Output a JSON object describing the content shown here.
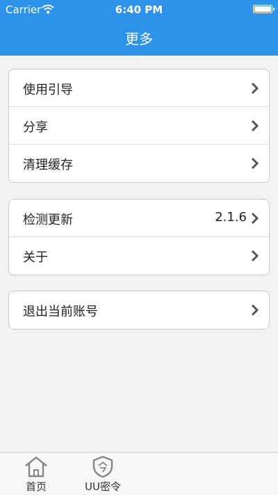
{
  "status_bar": {
    "carrier": "Carrier",
    "time": "6:40 PM"
  },
  "header": {
    "title": "更多"
  },
  "groups": [
    {
      "items": [
        {
          "label": "使用引导"
        },
        {
          "label": "分享"
        },
        {
          "label": "清理缓存"
        }
      ]
    },
    {
      "items": [
        {
          "label": "检测更新",
          "value": "2.1.6"
        },
        {
          "label": "关于"
        }
      ]
    },
    {
      "items": [
        {
          "label": "退出当前账号"
        }
      ]
    }
  ],
  "tabs": [
    {
      "label": "首页",
      "icon": "home-icon"
    },
    {
      "label": "UU密令",
      "icon": "shield-icon"
    }
  ],
  "colors": {
    "accent": "#2d92ea",
    "background": "#f2f2f2"
  }
}
